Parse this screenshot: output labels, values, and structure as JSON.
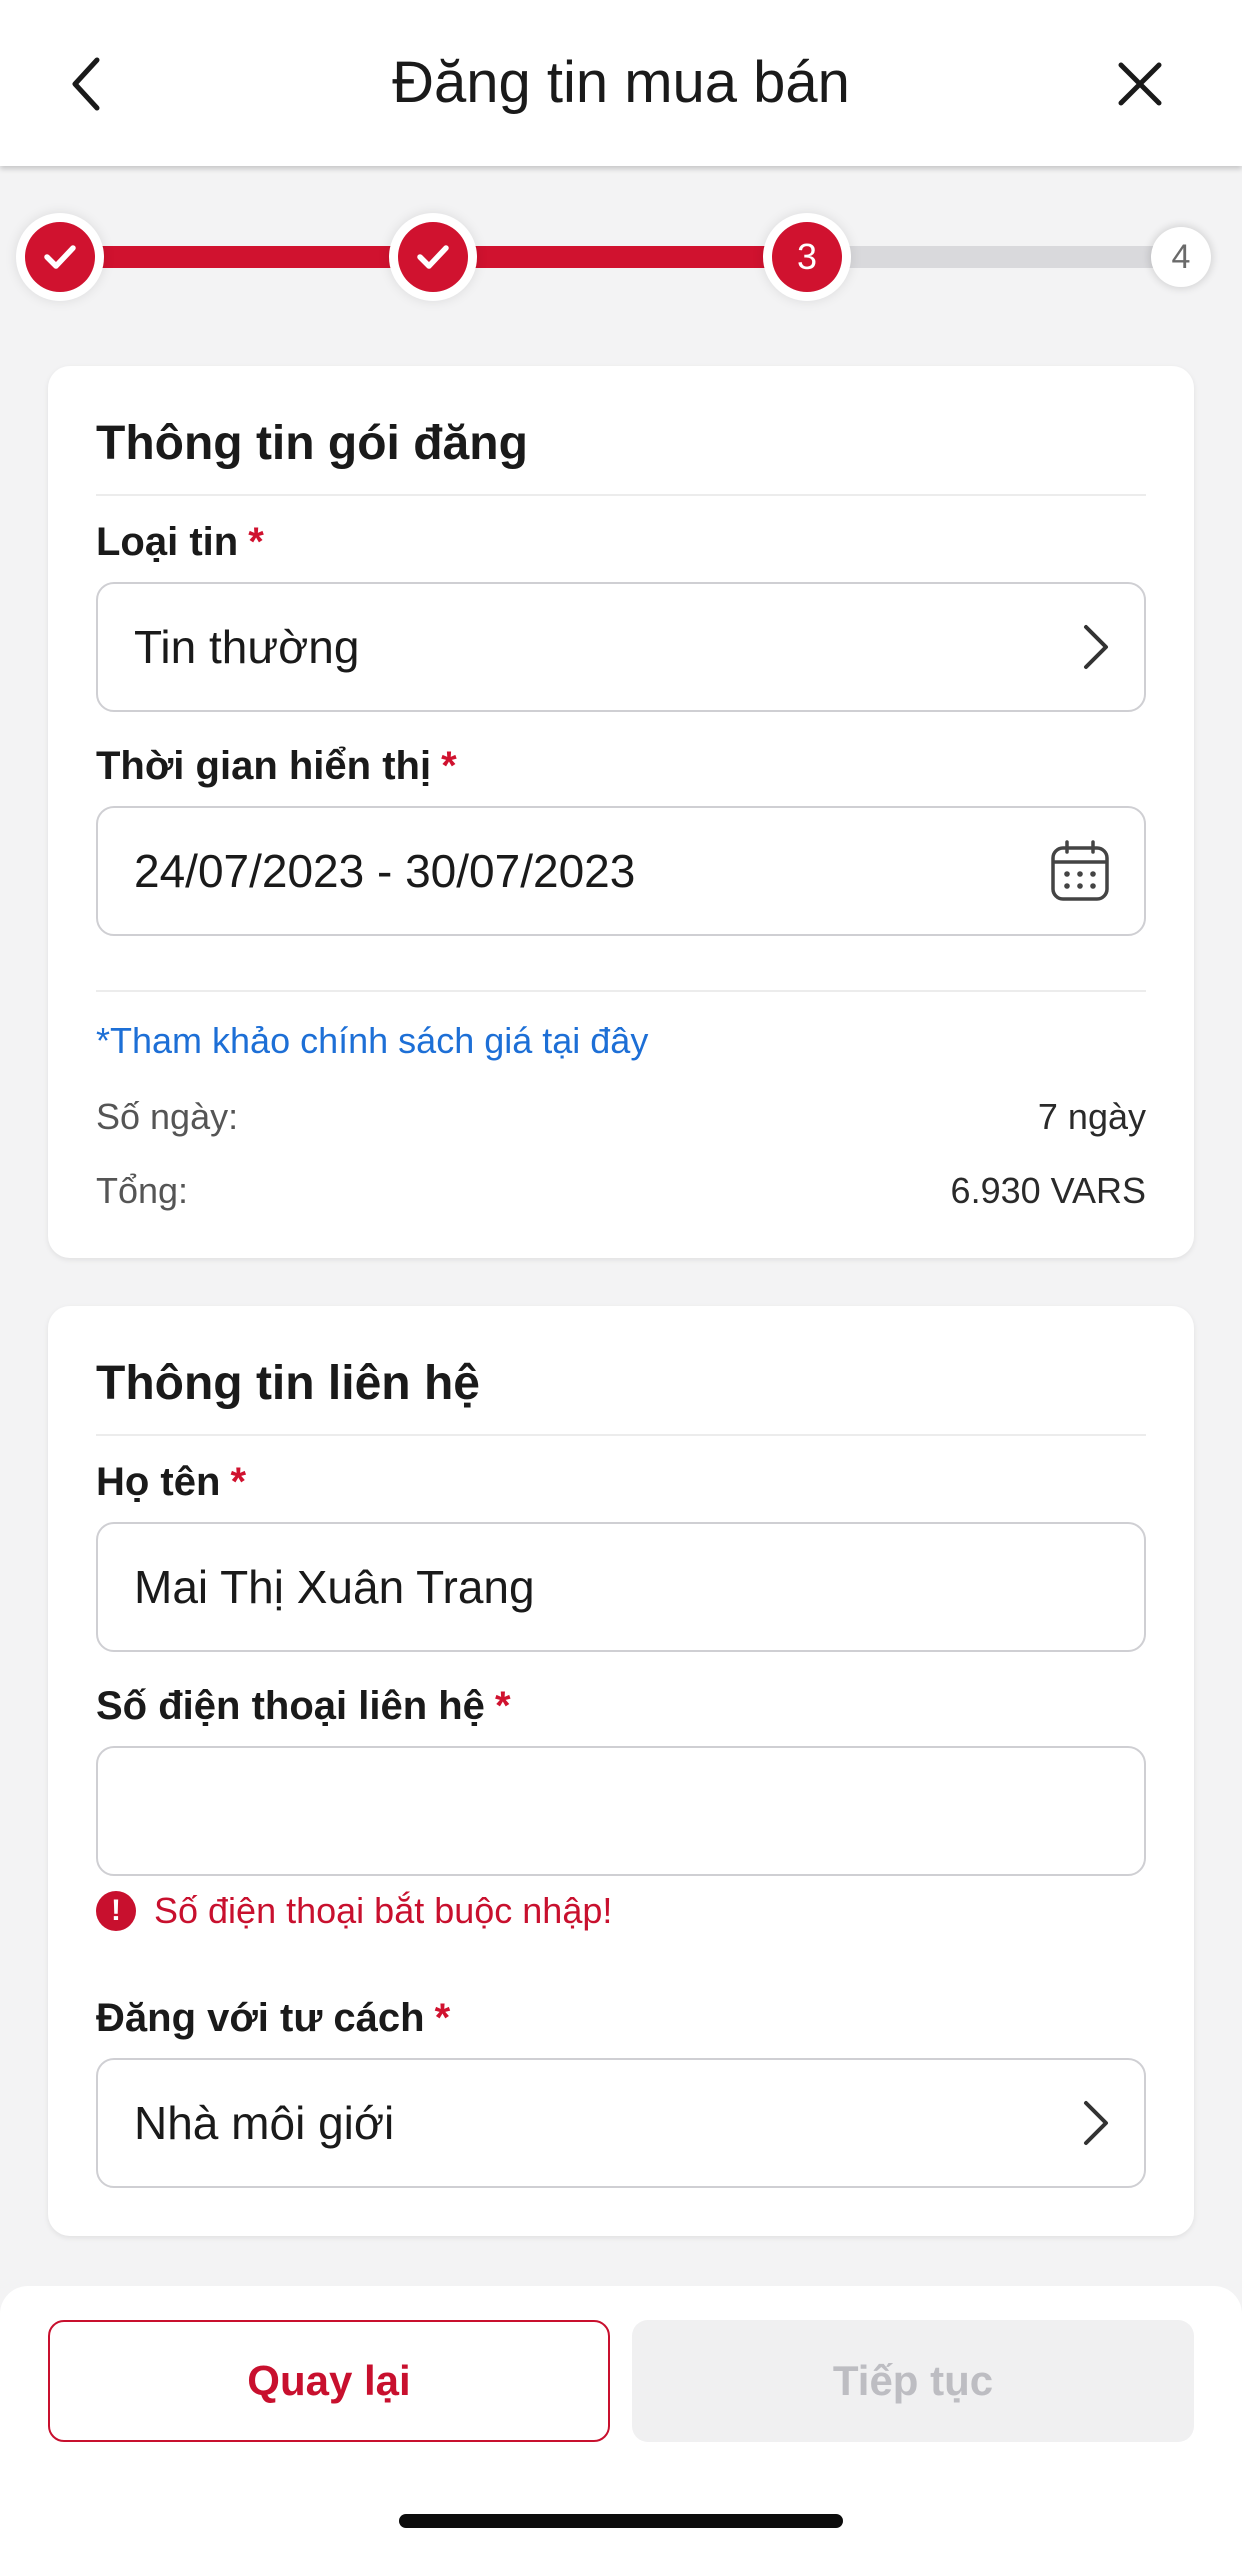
{
  "header": {
    "title": "Đăng tin mua bán",
    "back_icon": "chevron-left-icon",
    "close_icon": "close-icon"
  },
  "stepper": {
    "steps": [
      {
        "state": "done",
        "label": "",
        "icon": "check-icon"
      },
      {
        "state": "done",
        "label": "",
        "icon": "check-icon"
      },
      {
        "state": "current",
        "label": "3"
      },
      {
        "state": "todo",
        "label": "4"
      }
    ],
    "colors": {
      "active": "#d0122f",
      "inactive": "#d9d9dc"
    }
  },
  "package": {
    "title": "Thông tin gói đăng",
    "type_label": "Loại tin",
    "type_value": "Tin thường",
    "time_label": "Thời gian hiển thị",
    "time_value": "24/07/2023 - 30/07/2023",
    "required_mark": "*",
    "price_policy_link": "*Tham khảo chính sách giá tại đây",
    "days_label": "Số ngày:",
    "days_value": "7 ngày",
    "total_label": "Tổng:",
    "total_value": "6.930 VARS"
  },
  "contact": {
    "title": "Thông tin liên hệ",
    "name_label": "Họ tên",
    "name_value": "Mai Thị Xuân Trang",
    "phone_label": "Số điện thoại liên hệ",
    "phone_value": "",
    "phone_error": "Số điện thoại bắt buộc nhập!",
    "role_label": "Đăng với tư cách",
    "role_value": "Nhà môi giới",
    "required_mark": "*"
  },
  "footer": {
    "back_label": "Quay lại",
    "next_label": "Tiếp tục"
  },
  "colors": {
    "brand_red": "#d0122f",
    "link_blue": "#1d6fd6",
    "disabled_text": "#bdbdc2"
  }
}
